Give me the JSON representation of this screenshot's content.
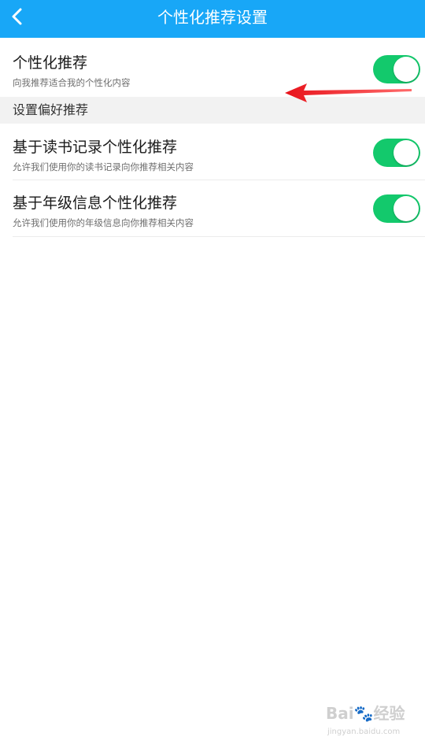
{
  "header": {
    "title": "个性化推荐设置",
    "back_icon": "chevron-left-icon"
  },
  "main_toggle": {
    "title": "个性化推荐",
    "subtitle": "向我推荐适合我的个性化内容",
    "enabled": true
  },
  "section": {
    "label": "设置偏好推荐"
  },
  "preferences": [
    {
      "title": "基于读书记录个性化推荐",
      "subtitle": "允许我们使用你的读书记录向你推荐相关内容",
      "enabled": true
    },
    {
      "title": "基于年级信息个性化推荐",
      "subtitle": "允许我们使用你的年级信息向你推荐相关内容",
      "enabled": true
    }
  ],
  "watermark": {
    "logo": "Bai🐾经验",
    "url": "jingyan.baidu.com"
  },
  "colors": {
    "header_bg": "#18a7f7",
    "toggle_on": "#13c96c",
    "arrow": "#e8131b",
    "section_bg": "#f2f2f2"
  }
}
